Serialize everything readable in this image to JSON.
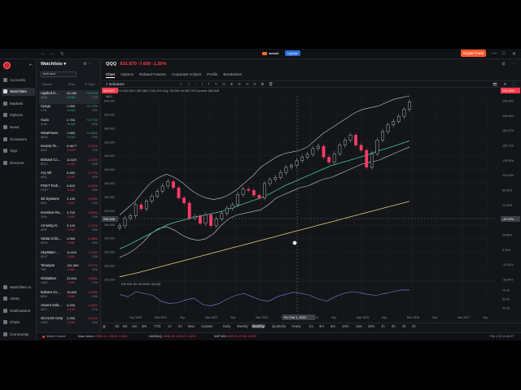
{
  "app": {
    "titlebar": {
      "logo": "webull",
      "badge": "Update",
      "digital_button": "Digital Trade",
      "minimize": "—",
      "maximize": "□",
      "close": "✕"
    },
    "leftnav": {
      "collapse_icon": "collapse-icon",
      "items": [
        {
          "label": "Accounts",
          "icon": "accounts-icon"
        },
        {
          "label": "Watchlists",
          "icon": "watchlist-icon",
          "active": true
        },
        {
          "label": "Markets",
          "icon": "markets-icon"
        },
        {
          "label": "Options",
          "icon": "options-icon"
        },
        {
          "label": "News",
          "icon": "news-icon"
        },
        {
          "label": "Screeners",
          "icon": "screener-icon"
        },
        {
          "label": "Algo",
          "icon": "algo-icon"
        },
        {
          "label": "Discover",
          "icon": "discover-icon"
        }
      ],
      "bottom_items": [
        {
          "label": "Watchlists AI",
          "icon": "ai-icon"
        },
        {
          "label": "Alerts",
          "icon": "alerts-icon"
        },
        {
          "label": "Notifications",
          "icon": "bell-icon"
        },
        {
          "label": "Chats",
          "icon": "chat-icon"
        },
        {
          "label": "Community",
          "icon": "community-icon"
        }
      ]
    },
    "watchlist": {
      "title": "Watchlists ▾",
      "select_value": "tech tech",
      "columns": {
        "symbol": "Symbol",
        "price": "Price",
        "chg": "% Chg ↕"
      },
      "rows": [
        {
          "name": "Applied D...",
          "ticker": "AAOI",
          "price": "25.260",
          "change": "+0.020",
          "pct": "+0.07%",
          "vol": "0.7%",
          "dir": "pos"
        },
        {
          "name": "Cyngn",
          "ticker": "CYN",
          "price": "1.390",
          "change": "+0.020",
          "pct": "+1.72%",
          "vol": "1.0%",
          "dir": "pos"
        },
        {
          "name": "Vuzix",
          "ticker": "VUZI",
          "price": "2.700",
          "change": "+0.020",
          "pct": "+0.77%",
          "vol": "2.0%",
          "dir": "pos"
        },
        {
          "name": "WisaPower",
          "ticker": "WISA",
          "price": "1.650",
          "change": "+0.010",
          "pct": "+1.54%",
          "vol": "0.3%",
          "dir": "pos"
        },
        {
          "name": "Innovia Te...",
          "ticker": "INVZ",
          "price": "0.9677",
          "change": "-0.0077",
          "pct": "-0.79%",
          "vol": "1.2%",
          "dir": "neg"
        },
        {
          "name": "Bolsard Co...",
          "ticker": "BOLT",
          "price": "11.620",
          "change": "-0.130",
          "pct": "-1.11%",
          "vol": "2.2%",
          "dir": "neg"
        },
        {
          "name": "Arq Intl",
          "ticker": "ARQ",
          "price": "9.260",
          "change": "-0.130",
          "pct": "-1.17%",
          "vol": "0.8%",
          "dir": "neg"
        },
        {
          "name": "POET Tech...",
          "ticker": "POET",
          "price": "5.820",
          "change": "-0.120",
          "pct": "-2.02%",
          "vol": "2.5%",
          "dir": "neg"
        },
        {
          "name": "3D Systems",
          "ticker": "DDD",
          "price": "2.130",
          "change": "-0.020",
          "pct": "-0.93%",
          "vol": "2.1%",
          "dir": "neg"
        },
        {
          "name": "Inventive Ro...",
          "ticker": "SIVA",
          "price": "3.700",
          "change": "-0.030",
          "pct": "-0.80%",
          "vol": "1.4%",
          "dir": "neg"
        },
        {
          "name": "Arrowhg AI",
          "ticker": "ARIF",
          "price": "3.120",
          "change": "-0.040",
          "pct": "-1.27%",
          "vol": "0.9%",
          "dir": "neg"
        },
        {
          "name": "Strata Critic...",
          "ticker": "SRTA",
          "price": "4.950",
          "change": "-0.080",
          "pct": "-1.59%",
          "vol": "0.6%",
          "dir": "neg"
        },
        {
          "name": "SkyWater ...",
          "ticker": "SKYT",
          "price": "11.600",
          "change": "-0.260",
          "pct": "-2.19%",
          "vol": "1.5%",
          "dir": "neg"
        },
        {
          "name": "Teradyne",
          "ticker": "TER",
          "price": "131.060",
          "change": "-3.050",
          "pct": "-2.27%",
          "vol": "3.0%",
          "dir": "neg"
        },
        {
          "name": "Globalstar",
          "ticker": "GSAT",
          "price": "23.910",
          "change": "-1.090",
          "pct": "-4.36%",
          "vol": "1.1%",
          "dir": "neg"
        },
        {
          "name": "Bolsam Co...",
          "ticker": "BBSI",
          "price": "15.800",
          "change": "-0.160",
          "pct": "-1.00%",
          "vol": "0.4%",
          "dir": "neg"
        },
        {
          "name": "Ascent Sola...",
          "ticker": "ASTI",
          "price": "4.290",
          "change": "-0.130",
          "pct": "-2.94%",
          "vol": "0.7%",
          "dir": "neg"
        },
        {
          "name": "SCALSG Corp",
          "ticker": "LAES",
          "price": "3.250",
          "change": "-0.150",
          "pct": "-4.41%",
          "vol": "2.6%",
          "dir": "neg"
        }
      ]
    },
    "main": {
      "symbol": "QQQ",
      "price_line": "631.870  -7.600  -1.20%",
      "tabs": [
        "Chart",
        "Options",
        "Related Futures",
        "Corporate Actions",
        "Profile",
        "Breakdown"
      ],
      "indicators_label": "Indicators",
      "ohlc_line": "O 597.150   H 632.920   L 591.080   C 631.870   Chg +30.590   Vol 867.7M   Turnover 546.91B",
      "ma_line": "MA 2",
      "current_price_tag": "631.870",
      "price_tag_right": "230.49%",
      "crosshair_label": "Fri, Feb 1, 2023",
      "crosshair_value": "-40.23%",
      "crosshair_price": "295.168",
      "rsi_label": "RSI  RSI: 69.753   RSI2: 60.045"
    },
    "bottom_toolbar": {
      "timeframes": [
        "1D",
        "5D",
        "1M",
        "3M",
        "YTD",
        "1Y",
        "3Y",
        "Max",
        "Custom",
        "Daily",
        "Weekly",
        "Monthly",
        "Quarterly",
        "Yearly",
        "1m",
        "3m",
        "5m",
        "10m",
        "15m",
        "30m",
        "1h",
        "2h",
        "3h",
        "4h"
      ],
      "active": "Monthly"
    },
    "statusbar": {
      "market_status": "Market Closed",
      "indices": [
        {
          "name": "Dow Jones",
          "value": "49955.12  -178.82  -0.36%"
        },
        {
          "name": "NASDAQ",
          "value": "23461.82  -240.42  -1.02%"
        },
        {
          "name": "S&P 500",
          "value": "6939.03  -29.98  -0.43%"
        }
      ],
      "datetime": "Feb 1 02:14:46 ET"
    }
  },
  "chart_data": {
    "type": "line",
    "title": "QQQ Monthly",
    "x_tick_labels": [
      "Sep 2020",
      "Mar 2021",
      "Sep",
      "Mar 2022",
      "Sep",
      "Mar 2023",
      "Sep",
      "Mar 2024",
      "Sep",
      "Mar 2025",
      "Sep",
      "Mar 2026",
      "Sep",
      "Mar 2027",
      "Sep"
    ],
    "y_tick_labels_left": [
      "640.000",
      "600.000",
      "560.000",
      "520.000",
      "480.000",
      "440.000",
      "400.000",
      "360.000",
      "320.000",
      "280.000",
      "240.000",
      "200.000",
      "160.000",
      "120.000"
    ],
    "y_tick_labels_right": [
      "230.49%",
      "208.00%",
      "181.07%",
      "150.73%",
      "135.00%",
      "116.44%",
      "90.00%",
      "73.15%",
      "51.01%",
      "29.88%",
      "8.23%",
      "-13.43%",
      "-36.05%"
    ],
    "ylim": [
      110,
      650
    ],
    "series": [
      {
        "name": "QQQ",
        "values": [
          268,
          290,
          298,
          330,
          318,
          340,
          355,
          370,
          385,
          398,
          380,
          350,
          335,
          290,
          296,
          275,
          300,
          268,
          288,
          304,
          320,
          330,
          360,
          376,
          372,
          358,
          350,
          392,
          404,
          410,
          425,
          440,
          445,
          460,
          470,
          478,
          495,
          502,
          470,
          455,
          480,
          505,
          520,
          535,
          505,
          490,
          440,
          480,
          520,
          545,
          565,
          575,
          590,
          610,
          631.87
        ]
      },
      {
        "name": "Upper Band",
        "values": [
          300,
          320,
          340,
          370,
          395,
          410,
          420,
          410,
          395,
          375,
          360,
          350,
          345,
          350,
          360,
          375,
          395,
          415,
          440,
          455,
          470,
          480,
          485,
          490,
          500,
          520,
          540,
          555,
          570,
          585,
          600,
          610,
          615,
          620,
          630,
          640,
          645,
          650
        ]
      },
      {
        "name": "Lower Band",
        "values": [
          175,
          185,
          200,
          220,
          245,
          260,
          265,
          255,
          240,
          230,
          225,
          230,
          245,
          270,
          290,
          300,
          305,
          310,
          315,
          330,
          350,
          360,
          370,
          380,
          385,
          395,
          405,
          410,
          420,
          430,
          440,
          450,
          455,
          460,
          470,
          480,
          490,
          500
        ]
      },
      {
        "name": "MA",
        "values": [
          200,
          210,
          222,
          234,
          246,
          258,
          270,
          278,
          284,
          290,
          296,
          300,
          305,
          310,
          318,
          326,
          334,
          342,
          350,
          360,
          372,
          385,
          395,
          405,
          415,
          425,
          435,
          445,
          452,
          458,
          465,
          472,
          480,
          488,
          495,
          502,
          510,
          518
        ]
      },
      {
        "name": "Long MA",
        "values": [
          118,
          124,
          130,
          137,
          144,
          151,
          158,
          165,
          172,
          179,
          186,
          193,
          200,
          207,
          214,
          221,
          228,
          235,
          242,
          249,
          256,
          263,
          270,
          277,
          284,
          291,
          298,
          305,
          312,
          319,
          326,
          333,
          340
        ]
      }
    ],
    "rsi": {
      "values": [
        60,
        55,
        66,
        62,
        58,
        45,
        40,
        42,
        48,
        52,
        38,
        35,
        40,
        50,
        58,
        62,
        55,
        48,
        45,
        55,
        60,
        65,
        62,
        58,
        50,
        45,
        55,
        62,
        66,
        64,
        60,
        58,
        62,
        66,
        70,
        69.75
      ],
      "ticks": [
        "70.00",
        "50.00",
        "30.00"
      ]
    },
    "grid": true,
    "legend": "none"
  }
}
